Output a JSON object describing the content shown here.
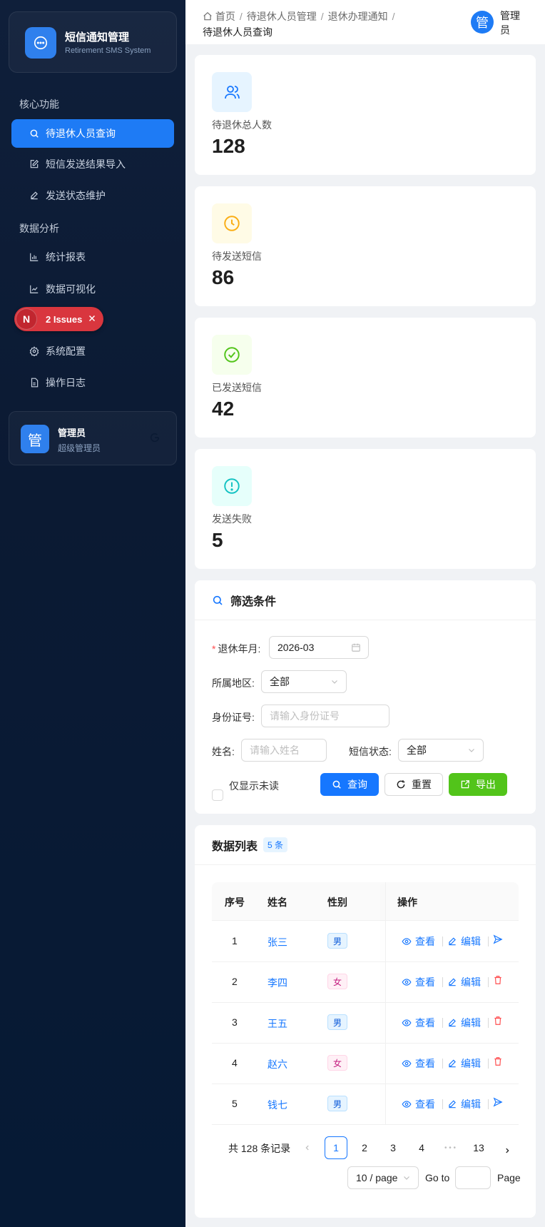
{
  "app": {
    "title": "短信通知管理",
    "subtitle": "Retirement SMS System"
  },
  "sidebar": {
    "group_core": "核心功能",
    "group_analysis": "数据分析",
    "items": [
      {
        "label": "待退休人员查询",
        "icon": "search-icon"
      },
      {
        "label": "短信发送结果导入",
        "icon": "edit-square-icon"
      },
      {
        "label": "发送状态维护",
        "icon": "edit-icon"
      },
      {
        "label": "统计报表",
        "icon": "bar-chart-icon"
      },
      {
        "label": "数据可视化",
        "icon": "line-chart-icon"
      },
      {
        "label": "系统配置",
        "icon": "gear-icon"
      },
      {
        "label": "操作日志",
        "icon": "file-icon"
      }
    ],
    "issues_badge": "2 Issues",
    "issues_letter": "N",
    "user": {
      "avatar": "管",
      "name": "管理员",
      "role": "超级管理员"
    }
  },
  "header": {
    "breadcrumb": [
      "首页",
      "待退休人员管理",
      "退休办理通知",
      "待退休人员查询"
    ],
    "avatar": "管",
    "user_name": "管理员"
  },
  "stats": [
    {
      "label": "待退休总人数",
      "value": "128",
      "icon": "user-group-icon",
      "color": "#1677ff",
      "bg": "#e6f4ff"
    },
    {
      "label": "待发送短信",
      "value": "86",
      "icon": "clock-icon",
      "color": "#faad14",
      "bg": "#fffbe6"
    },
    {
      "label": "已发送短信",
      "value": "42",
      "icon": "check-circle-icon",
      "color": "#52c41a",
      "bg": "#f6ffed"
    },
    {
      "label": "发送失败",
      "value": "5",
      "icon": "exclamation-circle-icon",
      "color": "#13c2c2",
      "bg": "#e6fffb"
    }
  ],
  "filter": {
    "title": "筛选条件",
    "retire_month_label": "退休年月:",
    "retire_month_value": "2026-03",
    "region_label": "所属地区:",
    "region_value": "全部",
    "id_label": "身份证号:",
    "id_placeholder": "请输入身份证号",
    "name_label": "姓名:",
    "name_placeholder": "请输入姓名",
    "sms_status_label": "短信状态:",
    "sms_status_value": "全部",
    "unread_only": "仅显示未读",
    "query_btn": "查询",
    "reset_btn": "重置",
    "export_btn": "导出"
  },
  "table": {
    "title": "数据列表",
    "count_badge": "5 条",
    "columns": [
      "序号",
      "姓名",
      "性别",
      "操作"
    ],
    "rows": [
      {
        "no": "1",
        "name": "张三",
        "gender": "男",
        "third_action": "send"
      },
      {
        "no": "2",
        "name": "李四",
        "gender": "女",
        "third_action": "delete"
      },
      {
        "no": "3",
        "name": "王五",
        "gender": "男",
        "third_action": "delete"
      },
      {
        "no": "4",
        "name": "赵六",
        "gender": "女",
        "third_action": "delete"
      },
      {
        "no": "5",
        "name": "钱七",
        "gender": "男",
        "third_action": "send"
      }
    ],
    "action_view": "查看",
    "action_edit": "编辑"
  },
  "pagination": {
    "total_text": "共 128 条记录",
    "pages": [
      "1",
      "2",
      "3",
      "4",
      "13"
    ],
    "current": "1",
    "ellipsis": "• • •",
    "page_size": "10 / page",
    "goto_label": "Go to",
    "page_label": "Page"
  }
}
